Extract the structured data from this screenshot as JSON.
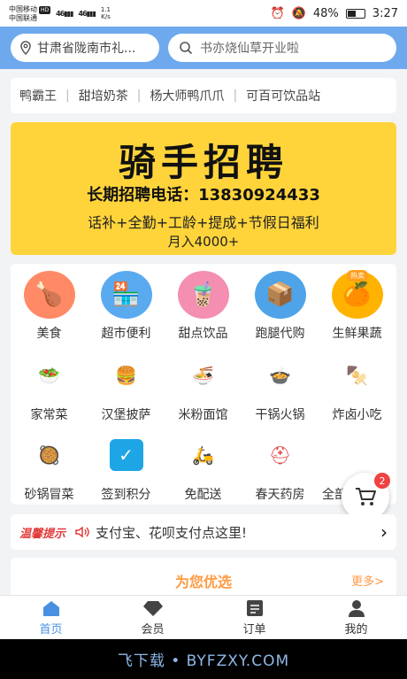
{
  "status_bar": {
    "carrier1": "中国移动",
    "carrier1_badge": "HD",
    "carrier2": "中国联通",
    "signal1": "46",
    "signal2": "46",
    "speed_value": "1.1",
    "speed_unit": "K/s",
    "battery": "48%",
    "time": "3:27"
  },
  "header": {
    "location": "甘肃省陇南市礼...",
    "search_placeholder": "书亦烧仙草开业啦"
  },
  "shops": [
    "鸭霸王",
    "甜培奶茶",
    "杨大师鸭爪爪",
    "可百可饮品站"
  ],
  "banner": {
    "title": "骑手招聘",
    "phone_line": "长期招聘电话：13830924433",
    "benefits": "话补+全勤+工龄+提成+节假日福利",
    "salary": "月入4000+"
  },
  "categories": [
    {
      "label": "美食",
      "icon": "roast-chicken-icon"
    },
    {
      "label": "超市便利",
      "icon": "store-icon"
    },
    {
      "label": "甜点饮品",
      "icon": "bubble-tea-icon"
    },
    {
      "label": "跑腿代购",
      "icon": "delivery-box-icon"
    },
    {
      "label": "生鲜果蔬",
      "icon": "orange-icon",
      "badge": "热卖"
    },
    {
      "label": "家常菜",
      "icon": "bowl-icon"
    },
    {
      "label": "汉堡披萨",
      "icon": "burger-icon"
    },
    {
      "label": "米粉面馆",
      "icon": "noodle-icon"
    },
    {
      "label": "干锅火锅",
      "icon": "hotpot-icon"
    },
    {
      "label": "炸卤小吃",
      "icon": "snack-stall-icon"
    },
    {
      "label": "砂锅冒菜",
      "icon": "claypot-icon"
    },
    {
      "label": "签到积分",
      "icon": "calendar-check-icon"
    },
    {
      "label": "免配送",
      "icon": "scooter-icon"
    },
    {
      "label": "春天药房",
      "icon": "pharmacy-icon"
    },
    {
      "label": "全部",
      "icon": "grid-icon"
    }
  ],
  "cart": {
    "count": "2"
  },
  "notice": {
    "tag": "温馨提示",
    "text": "支付宝、花呗支付点这里!"
  },
  "section": {
    "title": "为您优选",
    "more": "更多>"
  },
  "tabs": [
    {
      "label": "首页",
      "active": true
    },
    {
      "label": "会员",
      "active": false
    },
    {
      "label": "订单",
      "active": false
    },
    {
      "label": "我的",
      "active": false
    }
  ],
  "watermark": "飞下载 • BYFZXY.COM",
  "colors": {
    "header_bg": "#6ea9ee",
    "banner_bg": "#ffd43b",
    "accent": "#ff9a42",
    "tab_active": "#4a90e2"
  }
}
